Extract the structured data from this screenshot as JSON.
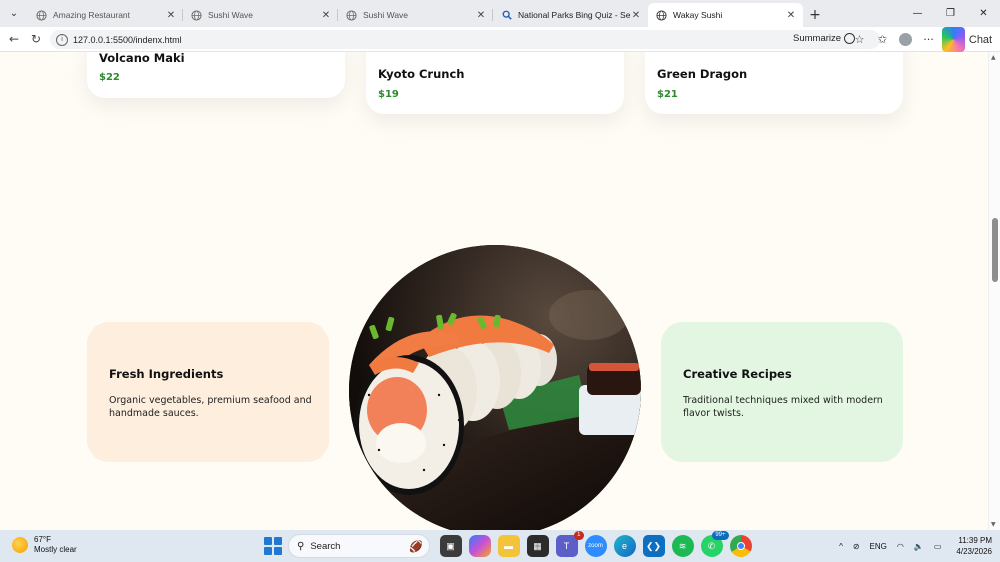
{
  "browser": {
    "tabs": [
      {
        "title": "Amazing Restaurant",
        "icon": "globe-icon",
        "active": false
      },
      {
        "title": "Sushi Wave",
        "icon": "globe-icon",
        "active": false
      },
      {
        "title": "Sushi Wave",
        "icon": "globe-icon",
        "active": false
      },
      {
        "title": "National Parks Bing Quiz - Search",
        "icon": "bing-search-icon",
        "active": false
      },
      {
        "title": "Wakay Sushi",
        "icon": "globe-icon",
        "active": true
      }
    ],
    "url": "127.0.0.1:5500/indenx.html",
    "summarize_label": "Summarize",
    "chat_label": "Chat"
  },
  "menu": [
    {
      "name": "Volcano Maki",
      "price": "$22"
    },
    {
      "name": "Kyoto Crunch",
      "price": "$19"
    },
    {
      "name": "Green Dragon",
      "price": "$21"
    }
  ],
  "features": [
    {
      "title": "Fresh Ingredients",
      "desc": "Organic vegetables, premium seafood and handmade sauces.",
      "bg": "#fdeedd"
    },
    {
      "title": "Creative Recipes",
      "desc": "Traditional techniques mixed with modern flavor twists.",
      "bg": "#e2f6e2"
    }
  ],
  "colors": {
    "page_bg": "#fffcf6",
    "price_green": "#2f8a2f"
  },
  "taskbar": {
    "weather_temp": "67°F",
    "weather_desc": "Mostly clear",
    "search_label": "Search",
    "language": "ENG",
    "time": "11:39 PM",
    "date": "4/23/2026",
    "teams_badge": "1",
    "whatsapp_badge": "99+"
  }
}
